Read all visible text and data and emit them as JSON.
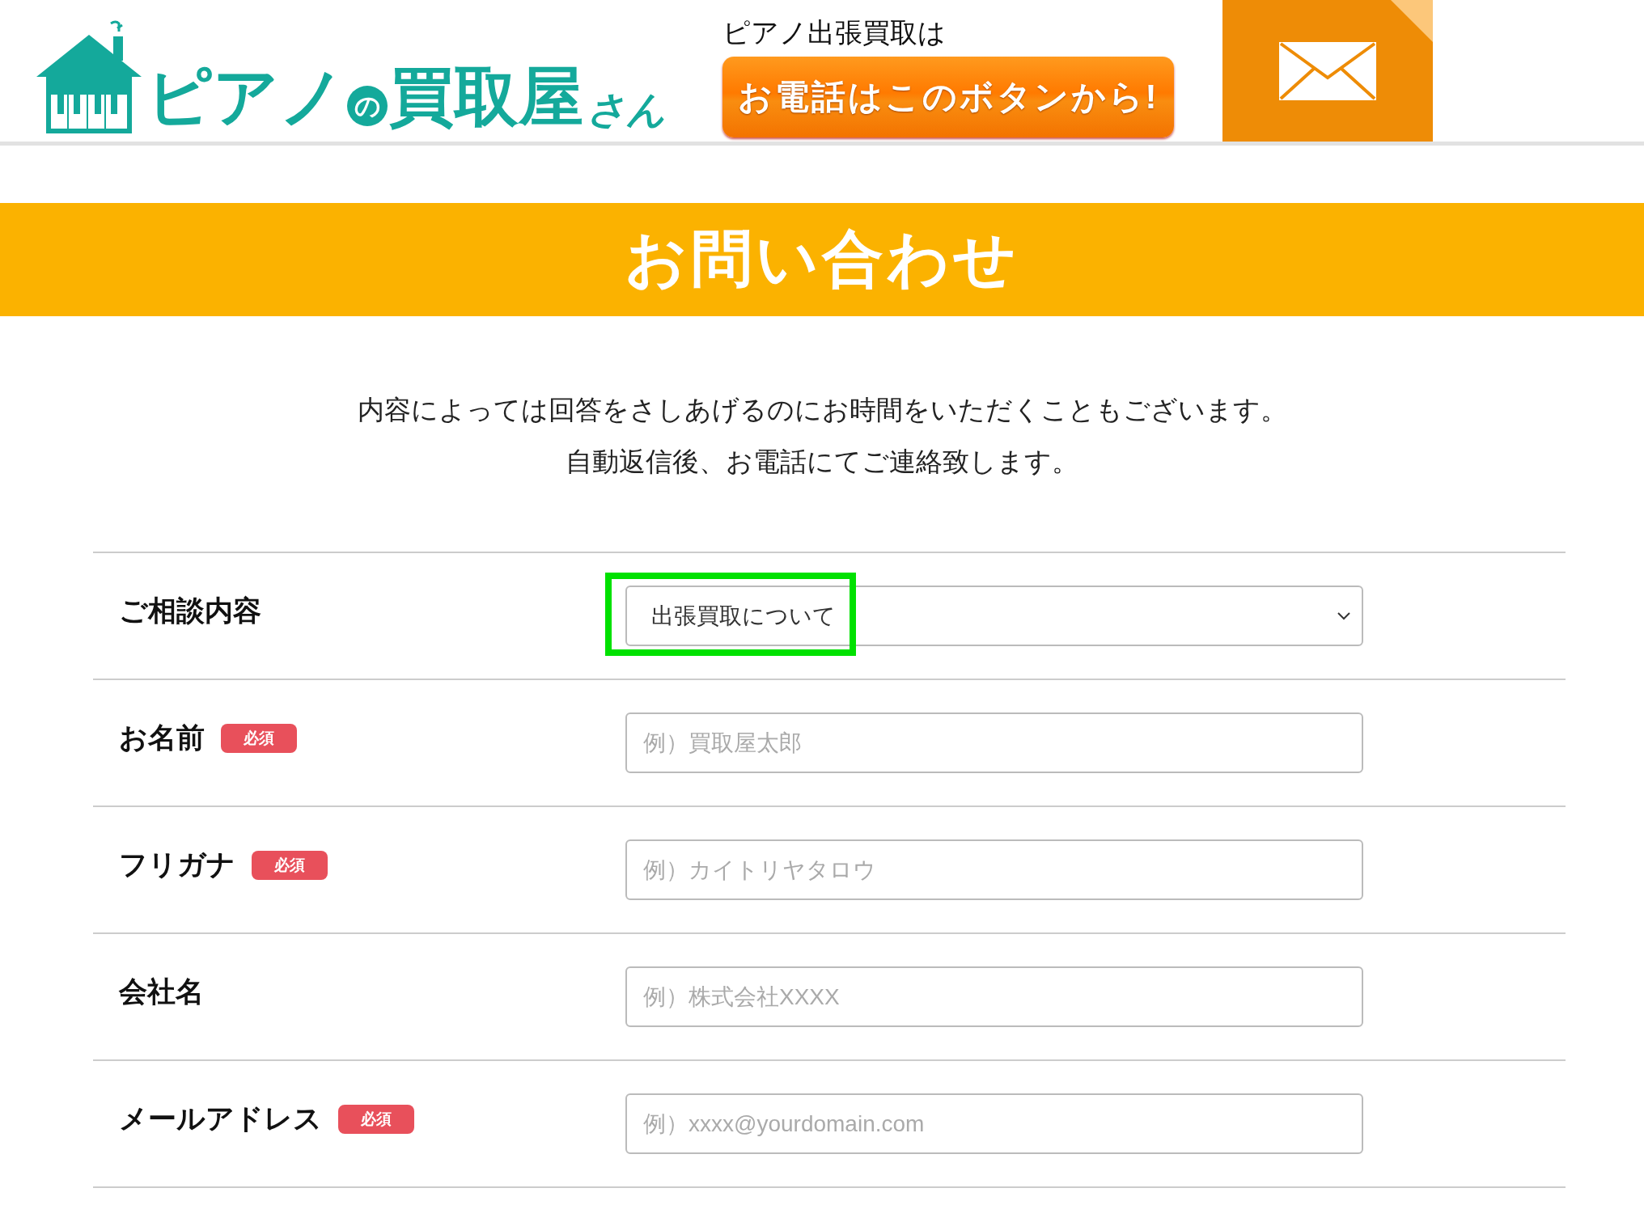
{
  "header": {
    "logo": {
      "parts": [
        "ピアノ",
        "の",
        "買取屋",
        "さん"
      ]
    },
    "phone_caption": "ピアノ出張買取は",
    "phone_button": "お電話はこのボタンから!"
  },
  "banner": {
    "title": "お問い合わせ"
  },
  "intro": [
    "内容によっては回答をさしあげるのにお時間をいただくこともございます。",
    "自動返信後、お電話にてご連絡致します。"
  ],
  "form": {
    "rows": [
      {
        "kind": "select",
        "label": "ご相談内容",
        "value": "出張買取について",
        "highlighted": true
      },
      {
        "kind": "text",
        "label": "お名前",
        "badge": "必須",
        "placeholder": "例）買取屋太郎"
      },
      {
        "kind": "text",
        "label": "フリガナ",
        "badge": "必須",
        "placeholder": "例）カイトリヤタロウ"
      },
      {
        "kind": "text",
        "label": "会社名",
        "placeholder": "例）株式会社XXXX"
      },
      {
        "kind": "text",
        "label": "メールアドレス",
        "badge": "必須",
        "placeholder": "例）xxxx@yourdomain.com"
      }
    ]
  }
}
